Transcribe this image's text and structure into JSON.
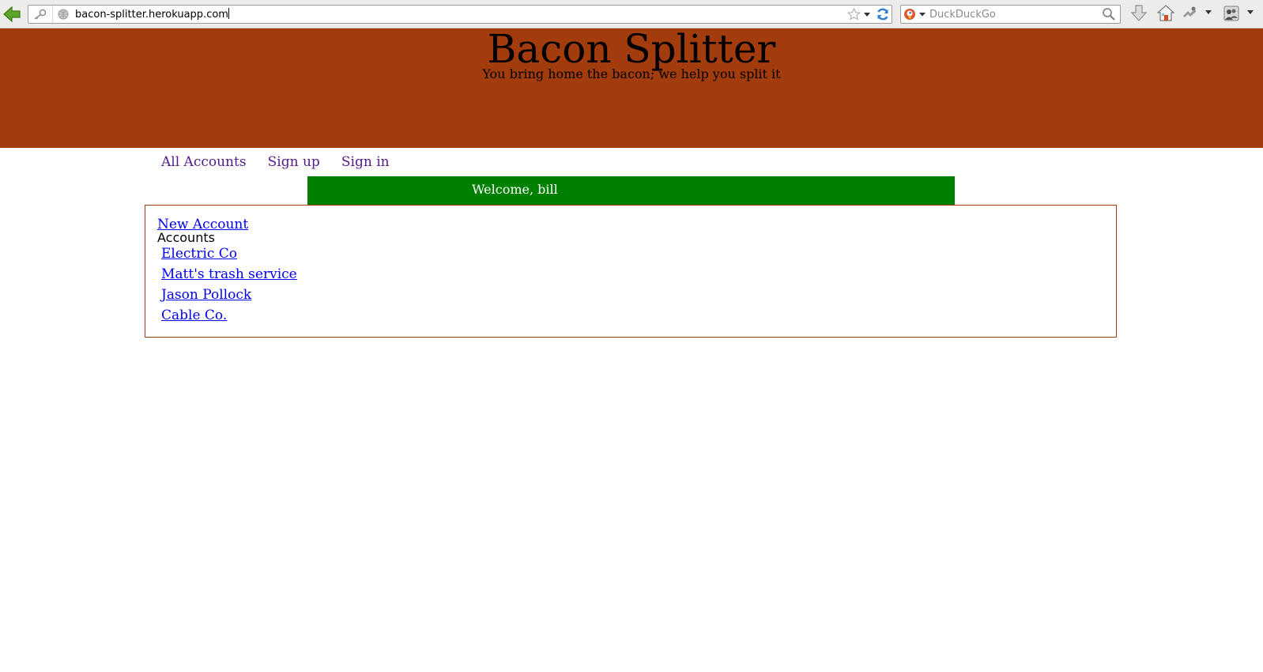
{
  "browser": {
    "url": "bacon-splitter.herokuapp.com",
    "search_placeholder": "DuckDuckGo"
  },
  "header": {
    "title": "Bacon Splitter",
    "tagline": "You bring home the bacon; we help you split it"
  },
  "nav": {
    "items": [
      {
        "label": "All Accounts"
      },
      {
        "label": "Sign up"
      },
      {
        "label": "Sign in"
      }
    ]
  },
  "flash": {
    "message": "Welcome, bill"
  },
  "main": {
    "new_account_label": "New Account",
    "accounts_heading": "Accounts",
    "accounts": [
      {
        "name": "Electric Co"
      },
      {
        "name": "Matt's trash service"
      },
      {
        "name": "Jason Pollock"
      },
      {
        "name": "Cable Co."
      }
    ]
  },
  "colors": {
    "header_bg": "#a33c0d",
    "flash_bg": "#008000",
    "nav_link": "#551a8b",
    "link": "#0000ee"
  }
}
